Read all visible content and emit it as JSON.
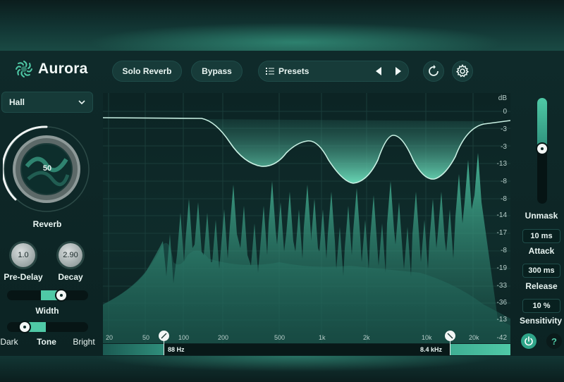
{
  "app": {
    "name": "Aurora"
  },
  "header": {
    "solo_label": "Solo Reverb",
    "bypass_label": "Bypass",
    "presets_label": "Presets"
  },
  "left": {
    "mode": "Hall",
    "reverb": {
      "value": "50",
      "label": "Reverb"
    },
    "predelay": {
      "value": "1.0",
      "label": "Pre-Delay"
    },
    "decay": {
      "value": "2.90",
      "label": "Decay"
    },
    "width": {
      "label": "Width",
      "level": 0.67
    },
    "tone": {
      "label": "Tone",
      "dark": "Dark",
      "bright": "Bright",
      "level": 0.22
    }
  },
  "display": {
    "db_unit": "dB",
    "db_scale": [
      "0",
      "-3",
      "-3",
      "-13",
      "-8",
      "-8",
      "-14",
      "-17",
      "-8",
      "-19",
      "-33",
      "-36",
      "-13",
      "-42"
    ],
    "freq_scale": [
      "20",
      "50",
      "100",
      "200",
      "500",
      "1k",
      "2k",
      "10k",
      "20k"
    ],
    "low_cut": "88 Hz",
    "high_cut": "8.4 kHz"
  },
  "right": {
    "unmask_label": "Unmask",
    "unmask_level": 0.48,
    "attack": {
      "value": "10 ms",
      "label": "Attack"
    },
    "release": {
      "value": "300 ms",
      "label": "Release"
    },
    "sensitivity": {
      "value": "10 %",
      "label": "Sensitivity"
    },
    "help_label": "?"
  },
  "colors": {
    "accent": "#4fc9a6",
    "background": "#0f2a2a",
    "panel": "#173b39"
  }
}
